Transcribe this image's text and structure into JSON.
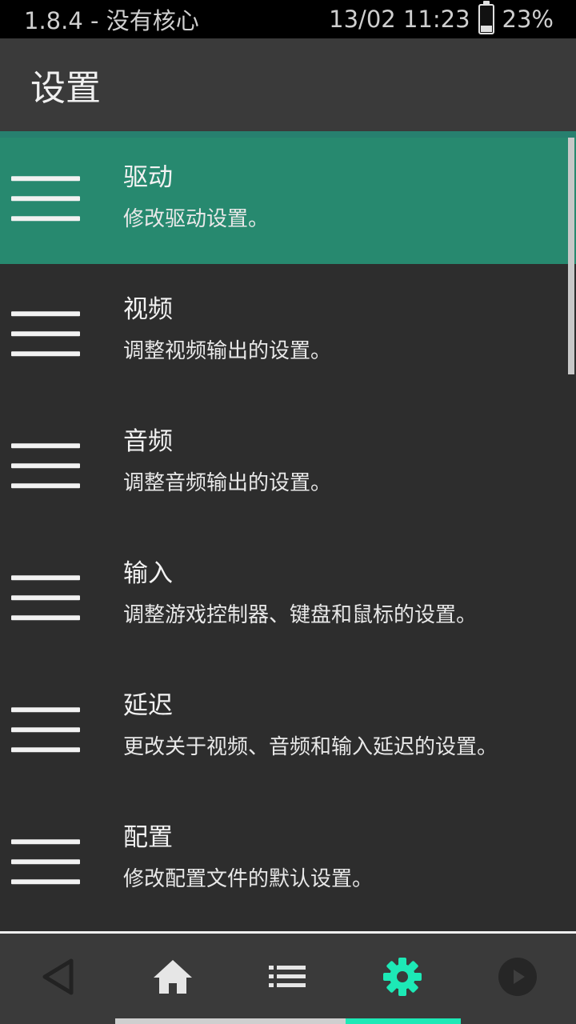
{
  "status": {
    "left_text": "1.8.4 - 没有核心",
    "datetime": "13/02 11:23",
    "battery_percent_text": "23%",
    "battery_level": 0.23
  },
  "header": {
    "title": "设置"
  },
  "settings_items": [
    {
      "title": "驱动",
      "desc": "修改驱动设置。"
    },
    {
      "title": "视频",
      "desc": "调整视频输出的设置。"
    },
    {
      "title": "音频",
      "desc": "调整音频输出的设置。"
    },
    {
      "title": "输入",
      "desc": "调整游戏控制器、键盘和鼠标的设置。"
    },
    {
      "title": "延迟",
      "desc": "更改关于视频、音频和输入延迟的设置。"
    },
    {
      "title": "配置",
      "desc": "修改配置文件的默认设置。"
    }
  ],
  "navbar": {
    "icons": [
      "back-icon",
      "home-icon",
      "list-icon",
      "gear-icon",
      "play-icon"
    ],
    "active_index": 3,
    "accent_color": "#1de9b6"
  },
  "colors": {
    "selected_row": "#27896f",
    "accent": "#1de9b6"
  }
}
